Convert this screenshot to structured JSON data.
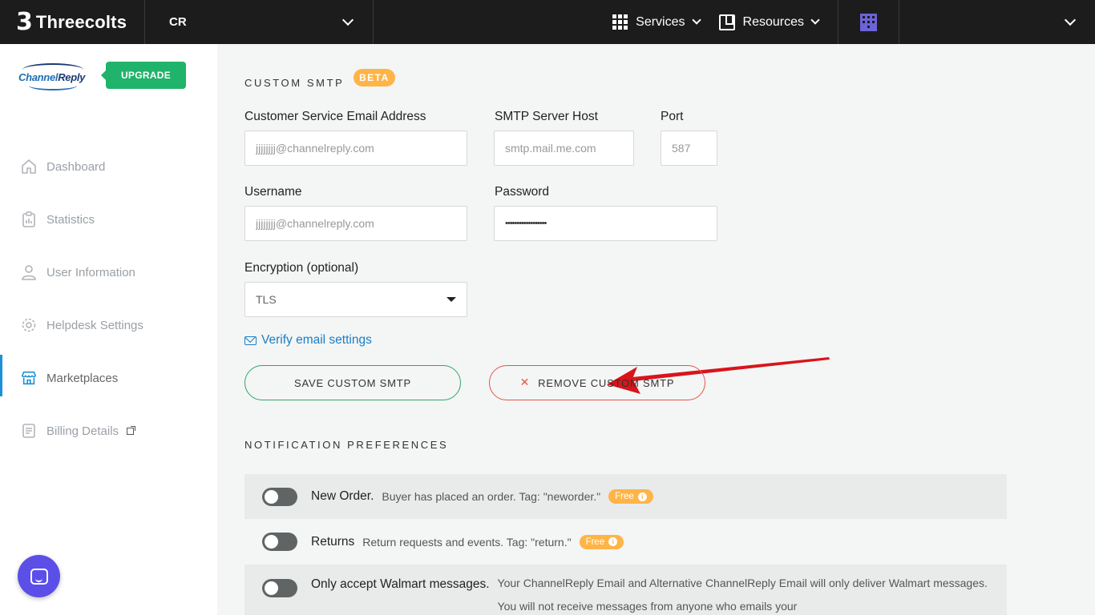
{
  "topbar": {
    "brand": "Threecolts",
    "workspace": "CR",
    "services_label": "Services",
    "resources_label": "Resources"
  },
  "sidebar": {
    "logo_text_a": "Channel",
    "logo_text_b": "Reply",
    "upgrade_label": "UPGRADE",
    "items": [
      {
        "label": "Dashboard",
        "icon": "home-icon"
      },
      {
        "label": "Statistics",
        "icon": "clipboard-icon"
      },
      {
        "label": "User Information",
        "icon": "user-icon"
      },
      {
        "label": "Helpdesk Settings",
        "icon": "gear-icon"
      },
      {
        "label": "Marketplaces",
        "icon": "store-icon",
        "active": true
      },
      {
        "label": "Billing Details",
        "icon": "receipt-icon",
        "external": true
      }
    ]
  },
  "smtp": {
    "section_title": "CUSTOM SMTP",
    "beta_badge": "BETA",
    "email_label": "Customer Service Email Address",
    "email_placeholder": "jjjjjjjj@channelreply.com",
    "host_label": "SMTP Server Host",
    "host_placeholder": "smtp.mail.me.com",
    "port_label": "Port",
    "port_placeholder": "587",
    "username_label": "Username",
    "username_placeholder": "jjjjjjjj@channelreply.com",
    "password_label": "Password",
    "password_value": "••••••••••••••••••",
    "encryption_label": "Encryption (optional)",
    "encryption_value": "TLS",
    "verify_link": "Verify email settings",
    "save_button": "SAVE CUSTOM SMTP",
    "remove_button": "REMOVE CUSTOM SMTP"
  },
  "notifications": {
    "section_title": "NOTIFICATION PREFERENCES",
    "items": [
      {
        "title": "New Order.",
        "desc": "Buyer has placed an order. Tag: \"neworder.\"",
        "badge": "Free",
        "enabled": false
      },
      {
        "title": "Returns",
        "desc": "Return requests and events. Tag: \"return.\"",
        "badge": "Free",
        "enabled": false
      },
      {
        "title": "Only accept Walmart messages.",
        "desc": "Your ChannelReply Email and Alternative ChannelReply Email will only deliver Walmart messages. You will not receive messages from anyone who emails your",
        "enabled": false
      }
    ]
  },
  "colors": {
    "accent_blue": "#1a7fc4",
    "success_green": "#20b36b",
    "danger_red": "#e6544c",
    "badge_orange": "#ffb447",
    "annotation_arrow": "#d9141b"
  }
}
